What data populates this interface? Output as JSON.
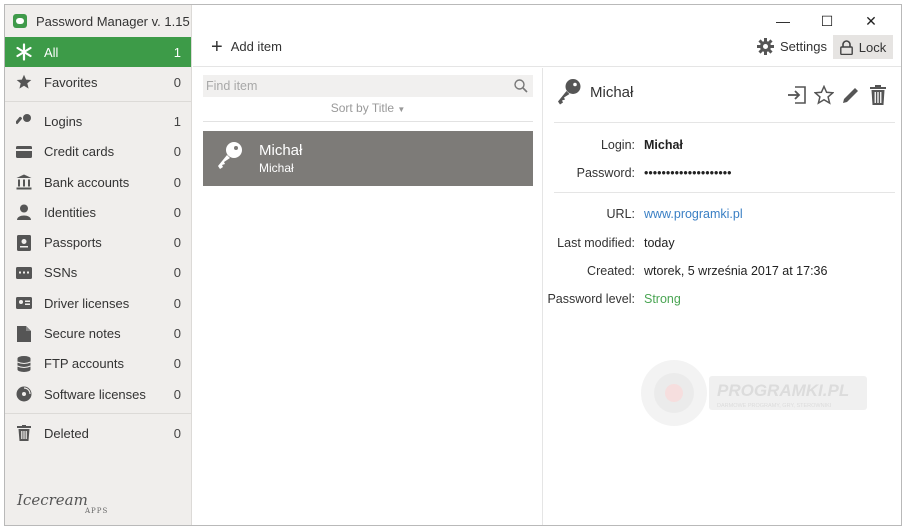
{
  "app": {
    "title": "Password Manager v. 1.15"
  },
  "window_controls": {
    "minimize": "—",
    "maximize": "☐",
    "close": "✕"
  },
  "sidebar": {
    "items": [
      {
        "label": "All",
        "count": "1"
      },
      {
        "label": "Favorites",
        "count": "0"
      },
      {
        "label": "Logins",
        "count": "1"
      },
      {
        "label": "Credit cards",
        "count": "0"
      },
      {
        "label": "Bank accounts",
        "count": "0"
      },
      {
        "label": "Identities",
        "count": "0"
      },
      {
        "label": "Passports",
        "count": "0"
      },
      {
        "label": "SSNs",
        "count": "0"
      },
      {
        "label": "Driver licenses",
        "count": "0"
      },
      {
        "label": "Secure notes",
        "count": "0"
      },
      {
        "label": "FTP accounts",
        "count": "0"
      },
      {
        "label": "Software licenses",
        "count": "0"
      },
      {
        "label": "Deleted",
        "count": "0"
      }
    ],
    "logo": "Icecream",
    "logo_sub": "APPS"
  },
  "toolbar": {
    "add_label": "Add item",
    "settings_label": "Settings",
    "lock_label": "Lock"
  },
  "list": {
    "search_placeholder": "Find item",
    "sort_label": "Sort by Title",
    "items": [
      {
        "title": "Michał",
        "subtitle": "Michał"
      }
    ]
  },
  "detail": {
    "title": "Michał",
    "login_label": "Login:",
    "login_value": "Michał",
    "password_label": "Password:",
    "password_value": "••••••••••••••••••••",
    "url_label": "URL:",
    "url_value": "www.programki.pl",
    "modified_label": "Last modified:",
    "modified_value": "today",
    "created_label": "Created:",
    "created_value": "wtorek, 5 września 2017 at 17:36",
    "level_label": "Password level:",
    "level_value": "Strong"
  },
  "watermark": {
    "brand": "PROGRAMKI.PL",
    "tagline": "DARMOWE PROGRAMY, GRY, STEROWNIKI"
  },
  "colors": {
    "accent": "#3d9b48",
    "selected_item": "#7d7b78",
    "link": "#3a7fc4",
    "strong": "#4aa553"
  }
}
